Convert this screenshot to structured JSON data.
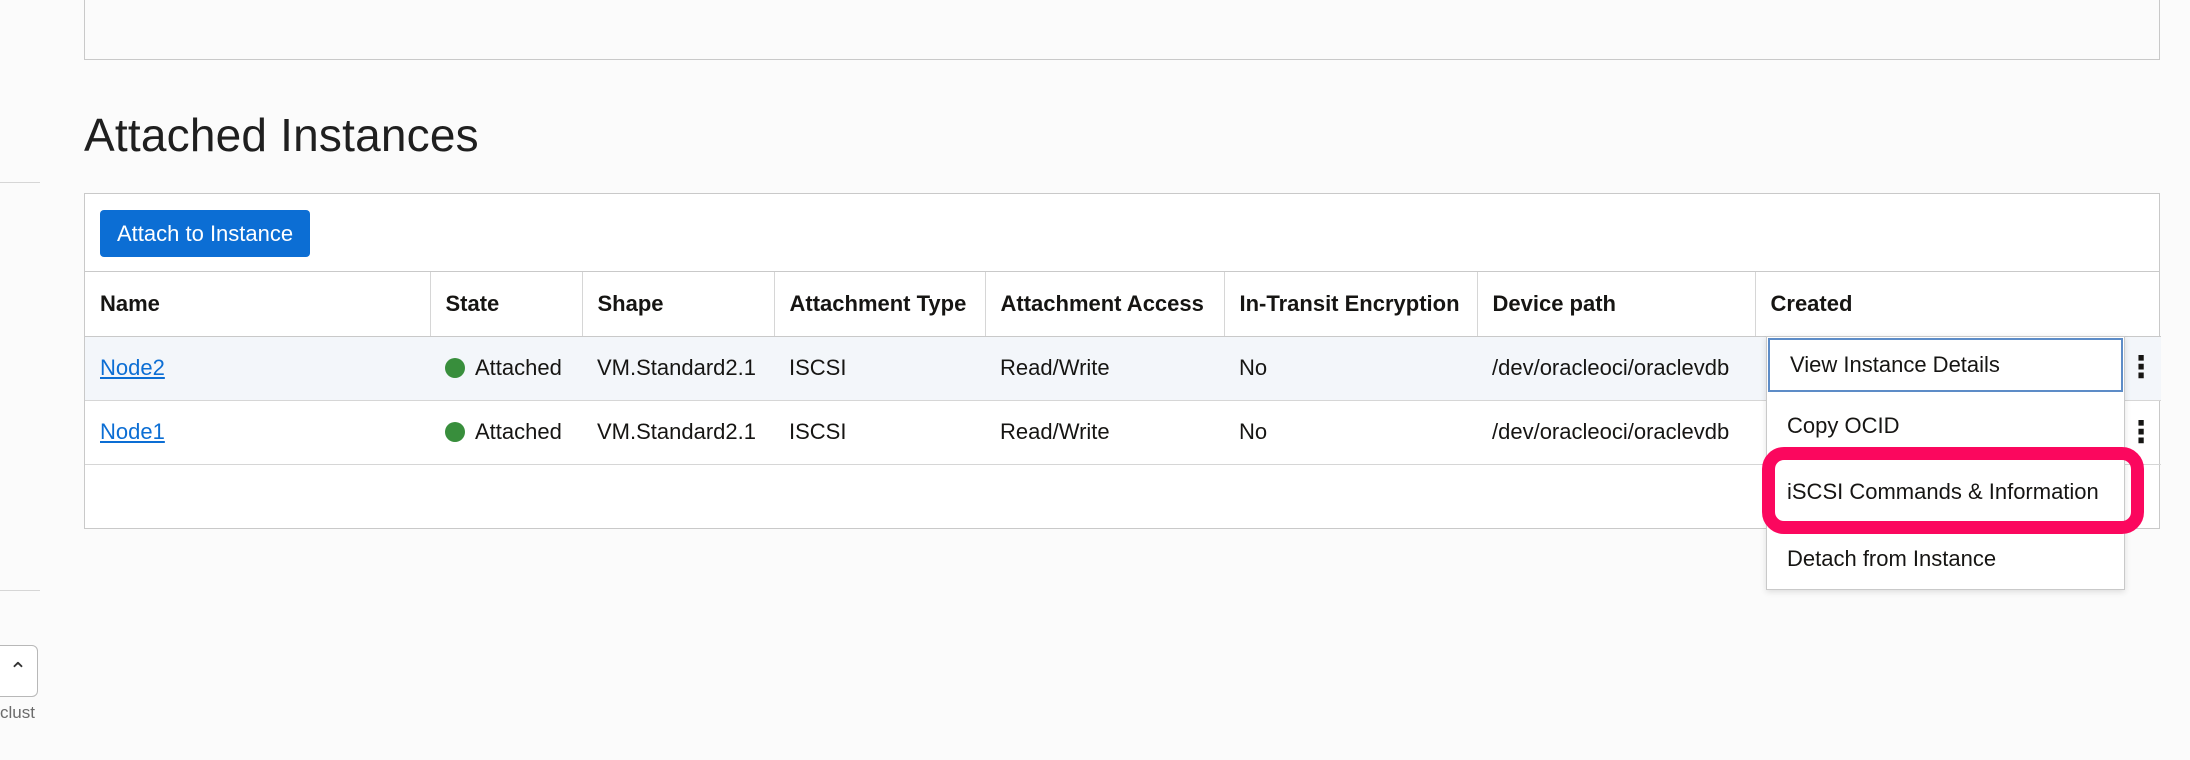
{
  "sidebar": {
    "truncated_label": "clust"
  },
  "section": {
    "title": "Attached Instances"
  },
  "toolbar": {
    "attach_label": "Attach to Instance"
  },
  "table": {
    "columns": [
      "Name",
      "State",
      "Shape",
      "Attachment Type",
      "Attachment Access",
      "In-Transit Encryption",
      "Device path",
      "Created"
    ],
    "rows": [
      {
        "name": "Node2",
        "state": "Attached",
        "shape": "VM.Standard2.1",
        "attachment_type": "ISCSI",
        "access": "Read/Write",
        "encryption": "No",
        "device_path": "/dev/oracleoci/oraclevdb"
      },
      {
        "name": "Node1",
        "state": "Attached",
        "shape": "VM.Standard2.1",
        "attachment_type": "ISCSI",
        "access": "Read/Write",
        "encryption": "No",
        "device_path": "/dev/oracleoci/oraclevdb"
      }
    ]
  },
  "menu": {
    "items": [
      "View Instance Details",
      "Copy OCID",
      "iSCSI Commands & Information",
      "Detach from Instance"
    ]
  },
  "colors": {
    "primary": "#0c6ed4",
    "status_attached": "#388e3c",
    "highlight": "#fb075e"
  },
  "icons": {
    "kebab": "more-vertical-icon",
    "status": "status-dot-icon",
    "stepper": "chevron-up-down-icon"
  }
}
